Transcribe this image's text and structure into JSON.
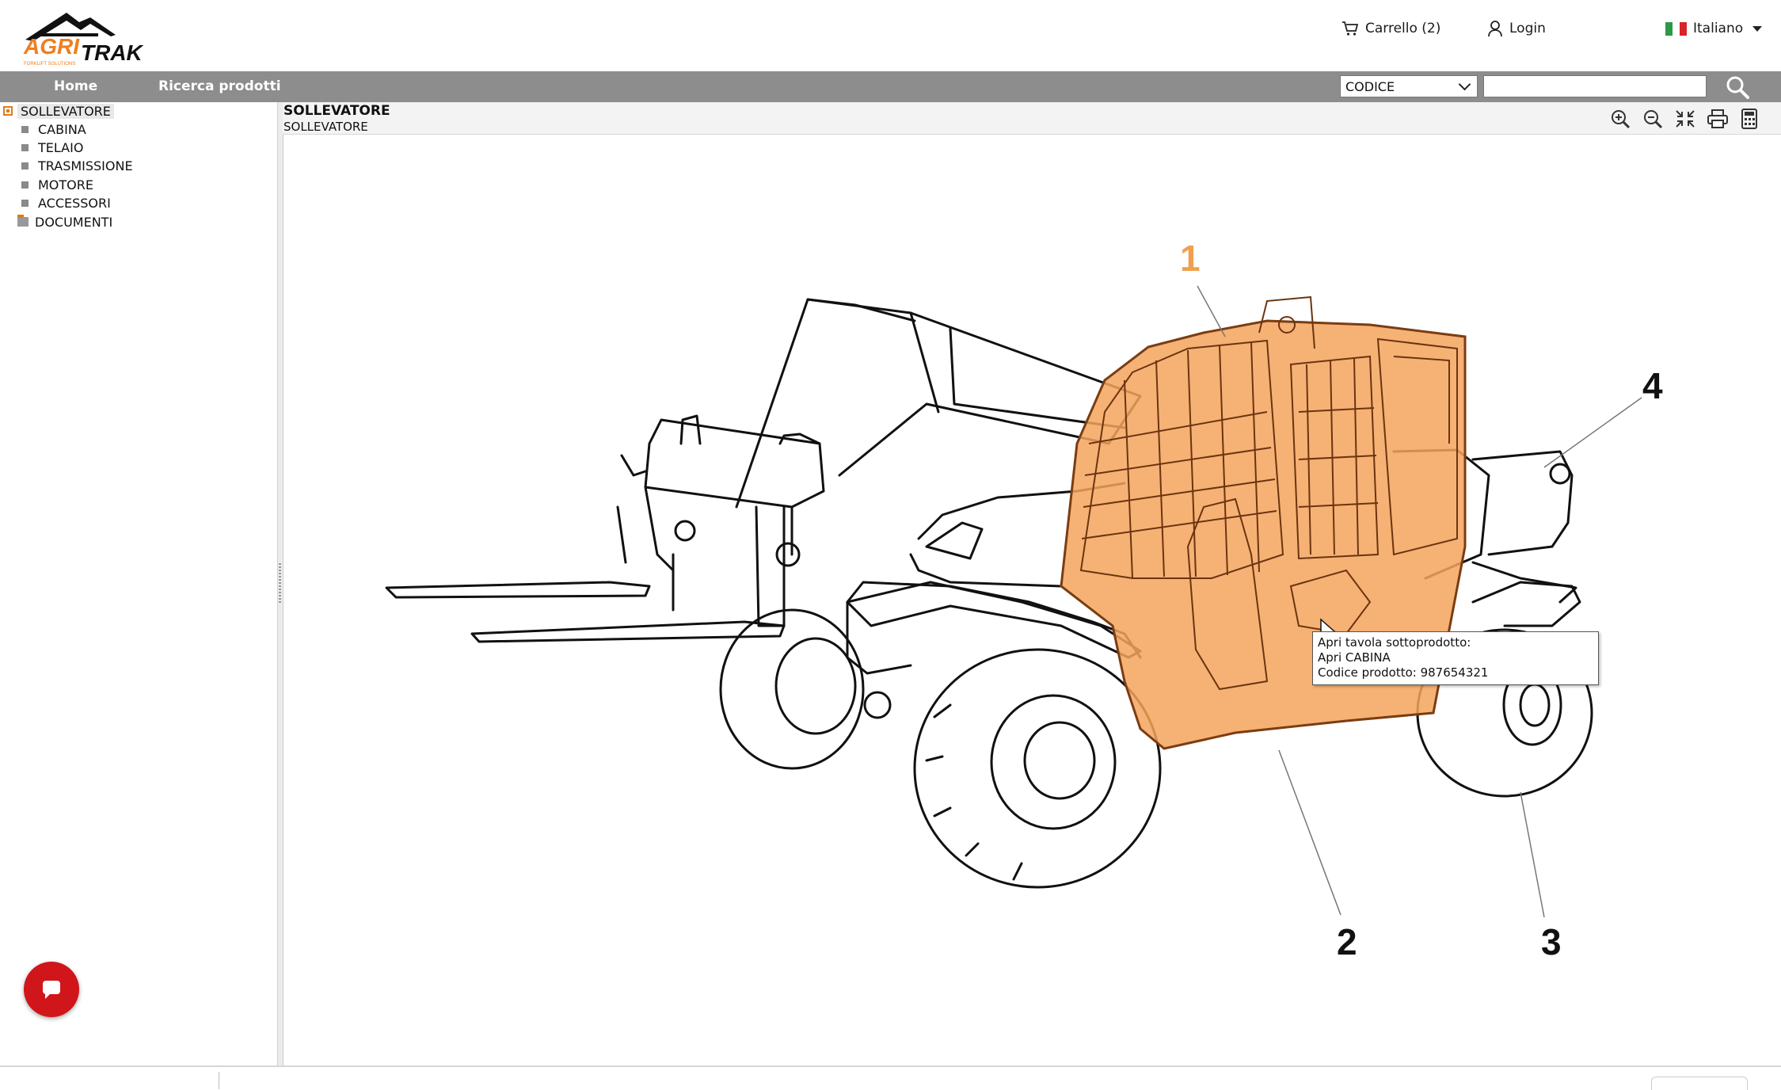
{
  "header": {
    "logo_text_top": "AGRI",
    "logo_text_bottom": "TRAK",
    "logo_tagline": "FORKLIFT SOLUTIONS",
    "cart_label": "Carrello (2)",
    "login_label": "Login",
    "language_label": "Italiano",
    "flag_colors": [
      "#2b9a46",
      "#ffffff",
      "#d8232a"
    ]
  },
  "nav": {
    "home_label": "Home",
    "search_products_label": "Ricerca prodotti",
    "search_type_selected": "CODICE",
    "search_value": ""
  },
  "sidebar": {
    "root_label": "SOLLEVATORE",
    "items": [
      {
        "label": "CABINA"
      },
      {
        "label": "TELAIO"
      },
      {
        "label": "TRASMISSIONE"
      },
      {
        "label": "MOTORE"
      },
      {
        "label": "ACCESSORI"
      }
    ],
    "documents_label": "DOCUMENTI"
  },
  "content": {
    "title": "SOLLEVATORE",
    "subtitle": "SOLLEVATORE",
    "toolbar": [
      "zoom-in-icon",
      "zoom-out-icon",
      "collapse-icon",
      "print-icon",
      "calculator-icon"
    ]
  },
  "diagram": {
    "callouts": [
      "1",
      "2",
      "3",
      "4"
    ],
    "highlight_color": "#f5a35c",
    "highlight_callout_color": "#f0a050"
  },
  "tooltip": {
    "line1": "Apri tavola sottoprodotto:",
    "line2": "Apri CABINA",
    "line3": "Codice prodotto: 987654321"
  },
  "colors": {
    "nav_bg": "#8d8d8d",
    "accent": "#e07b18",
    "chat": "#d0161a"
  }
}
